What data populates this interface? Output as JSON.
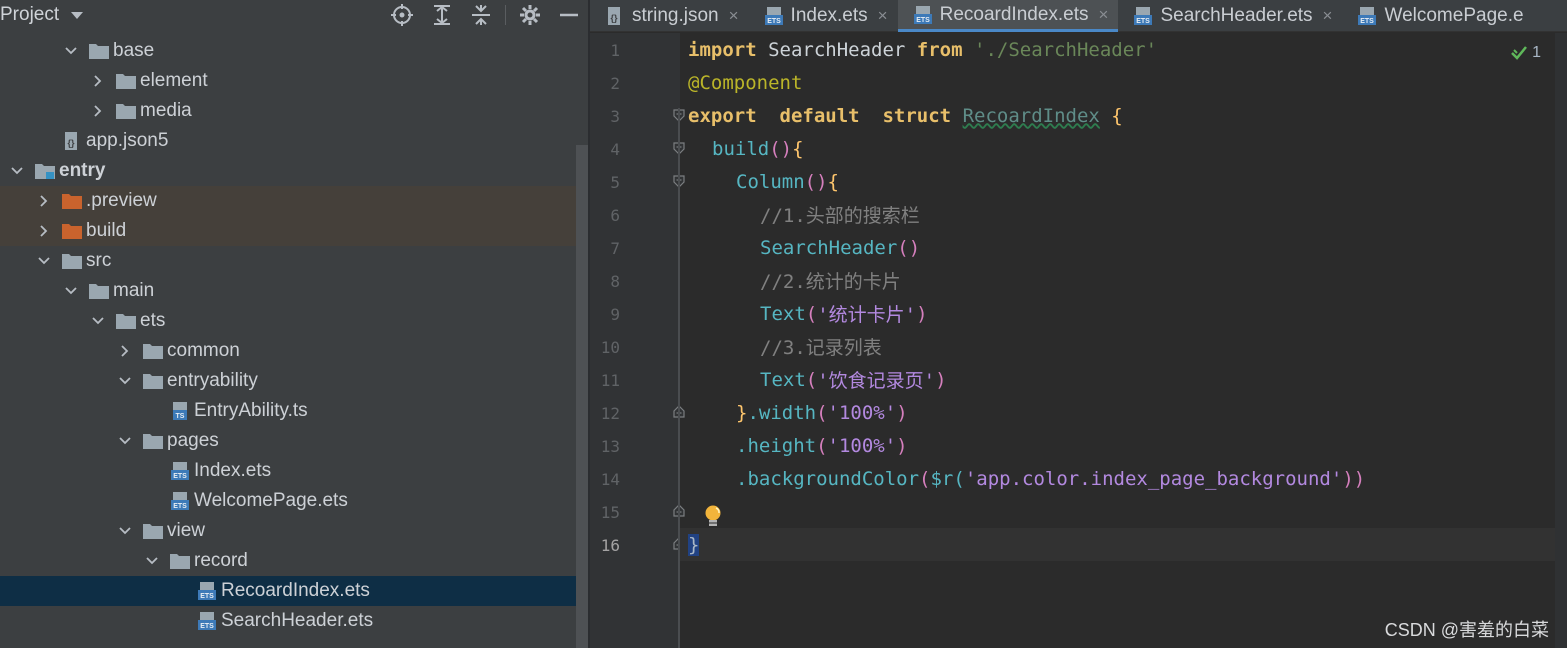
{
  "project_panel": {
    "title": "Project",
    "toolbar_icons": [
      "locate-icon",
      "expand-all-icon",
      "collapse-all-icon",
      "gear-icon",
      "minimize-icon"
    ],
    "tree": [
      {
        "label": "base",
        "type": "folder",
        "expanded": true
      },
      {
        "label": "element",
        "type": "folder",
        "expanded": false
      },
      {
        "label": "media",
        "type": "folder",
        "expanded": false
      },
      {
        "label": "app.json5",
        "type": "json-file"
      },
      {
        "label": "entry",
        "type": "module",
        "expanded": true
      },
      {
        "label": ".preview",
        "type": "orange-folder",
        "expanded": false
      },
      {
        "label": "build",
        "type": "orange-folder",
        "expanded": false
      },
      {
        "label": "src",
        "type": "folder",
        "expanded": true
      },
      {
        "label": "main",
        "type": "folder",
        "expanded": true
      },
      {
        "label": "ets",
        "type": "folder",
        "expanded": true
      },
      {
        "label": "common",
        "type": "folder",
        "expanded": false
      },
      {
        "label": "entryability",
        "type": "folder",
        "expanded": true
      },
      {
        "label": "EntryAbility.ts",
        "type": "ts-file"
      },
      {
        "label": "pages",
        "type": "folder",
        "expanded": true
      },
      {
        "label": "Index.ets",
        "type": "ets-file"
      },
      {
        "label": "WelcomePage.ets",
        "type": "ets-file"
      },
      {
        "label": "view",
        "type": "folder",
        "expanded": true
      },
      {
        "label": "record",
        "type": "folder",
        "expanded": true
      },
      {
        "label": "RecoardIndex.ets",
        "type": "ets-file",
        "selected": true
      },
      {
        "label": "SearchHeader.ets",
        "type": "ets-file"
      }
    ]
  },
  "editor": {
    "tabs": [
      {
        "label": "string.json",
        "icon": "json-file-icon",
        "close": "×"
      },
      {
        "label": "Index.ets",
        "icon": "ets-file-icon",
        "close": "×"
      },
      {
        "label": "RecoardIndex.ets",
        "icon": "ets-file-icon",
        "close": "×",
        "active": true
      },
      {
        "label": "SearchHeader.ets",
        "icon": "ets-file-icon",
        "close": "×"
      },
      {
        "label": "WelcomePage.e",
        "icon": "ets-file-icon",
        "close": ""
      }
    ],
    "line_numbers": [
      "1",
      "2",
      "3",
      "4",
      "5",
      "6",
      "7",
      "8",
      "9",
      "10",
      "11",
      "12",
      "13",
      "14",
      "15",
      "16"
    ],
    "current_line": "16",
    "inspection_count": "1",
    "code": {
      "l1_kw1": "import",
      "l1_id": " SearchHeader ",
      "l1_kw2": "from",
      "l1_str": " './SearchHeader'",
      "l2_ann": "@Component",
      "l3_kw1": "export",
      "l3_kw2": "  default",
      "l3_kw3": "  struct",
      "l3_name": "RecoardIndex",
      "l3_brace": " {",
      "l4_fn": "build",
      "l4_paren": "()",
      "l4_brace": "{",
      "l5_fn": "Column",
      "l5_paren": "()",
      "l5_brace": "{",
      "l6_cm": "//1.头部的搜索栏",
      "l7_fn": "SearchHeader",
      "l7_paren": "()",
      "l8_cm": "//2.统计的卡片",
      "l9_fn": "Text",
      "l9_open": "(",
      "l9_str": "'统计卡片'",
      "l9_close": ")",
      "l10_cm": "//3.记录列表",
      "l11_fn": "Text",
      "l11_open": "(",
      "l11_str": "'饮食记录页'",
      "l11_close": ")",
      "l12_brace": "}",
      "l12_fn": ".width",
      "l12_open": "(",
      "l12_str": "'100%'",
      "l12_close": ")",
      "l13_fn": ".height",
      "l13_open": "(",
      "l13_str": "'100%'",
      "l13_close": ")",
      "l14_fn": ".backgroundColor",
      "l14_open": "(",
      "l14_fn2": "$r",
      "l14_open2": "(",
      "l14_str": "'app.color.index_page_background'",
      "l14_close": "))",
      "l16_brace": "}"
    }
  },
  "watermark": "CSDN @害羞的白菜"
}
